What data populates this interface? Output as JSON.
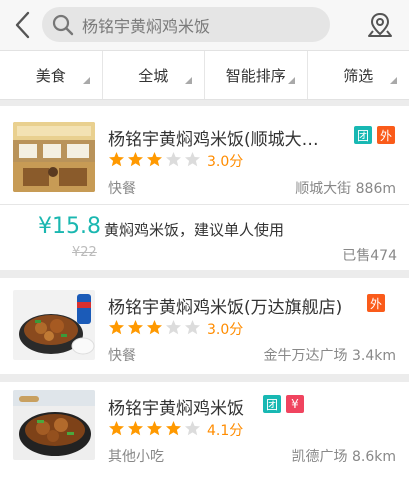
{
  "search": {
    "query": "杨铭宇黄焖鸡米饭"
  },
  "filters": [
    {
      "label": "美食"
    },
    {
      "label": "全城"
    },
    {
      "label": "智能排序"
    },
    {
      "label": "筛选"
    }
  ],
  "icons": {
    "back": "chevron-left-icon",
    "search": "search-icon",
    "map": "map-pin-icon",
    "star": "star-icon"
  },
  "colors": {
    "accent_teal": "#1ab7b0",
    "star_orange": "#ff9900",
    "badge_tuan": "#18b8b3",
    "badge_wai": "#fa5b1a",
    "badge_jian": "#f0445f"
  },
  "listings": [
    {
      "name": "杨铭宇黄焖鸡米饭(顺城大…",
      "badges": [
        "团",
        "外"
      ],
      "rating": 3,
      "score": "3.0分",
      "category": "快餐",
      "location": "顺城大街 886m",
      "deal": {
        "price": "¥15.8",
        "old_price": "¥22",
        "description": "黄焖鸡米饭，建议单人使用",
        "sold": "已售474"
      }
    },
    {
      "name": "杨铭宇黄焖鸡米饭(万达旗舰店)",
      "badges": [
        "外"
      ],
      "rating": 3,
      "score": "3.0分",
      "category": "快餐",
      "location": "金牛万达广场 3.4km"
    },
    {
      "name": "杨铭宇黄焖鸡米饭",
      "badges": [
        "团",
        "¥"
      ],
      "rating": 4,
      "score": "4.1分",
      "category": "其他小吃",
      "location": "凯德广场 8.6km"
    }
  ]
}
